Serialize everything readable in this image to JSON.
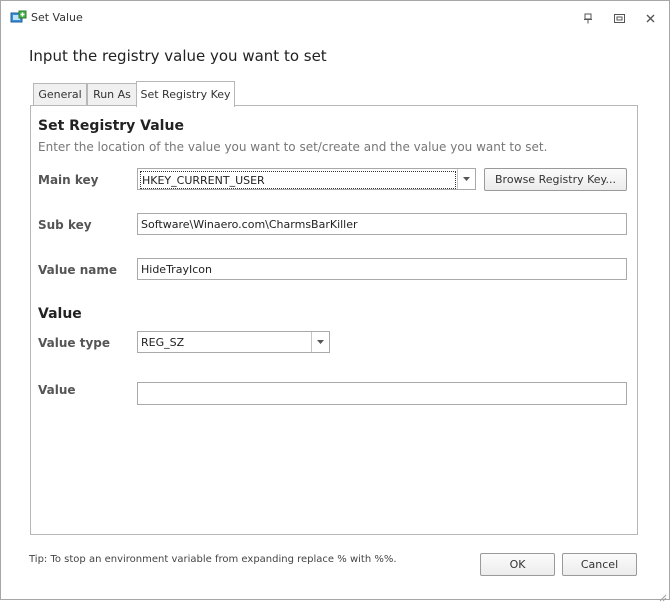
{
  "window": {
    "title": "Set Value",
    "icon": "registry-window-icon",
    "controls": [
      "pin-icon",
      "restore-icon",
      "close-icon"
    ]
  },
  "heading": "Input the registry value you want to set",
  "tabs": [
    {
      "label": "General",
      "active": false
    },
    {
      "label": "Run As",
      "active": false
    },
    {
      "label": "Set Registry Key",
      "active": true
    }
  ],
  "registry": {
    "section_title": "Set Registry Value",
    "description": "Enter the location of the value you want to set/create and the value you want to set.",
    "main_key_label": "Main key",
    "main_key_value": "HKEY_CURRENT_USER",
    "browse_label": "Browse Registry Key...",
    "sub_key_label": "Sub key",
    "sub_key_value": "Software\\Winaero.com\\CharmsBarKiller",
    "value_name_label": "Value name",
    "value_name_value": "HideTrayIcon"
  },
  "value_section": {
    "title": "Value",
    "type_label": "Value type",
    "type_value": "REG_SZ",
    "value_label": "Value",
    "value_value": ""
  },
  "footer": {
    "tip": "Tip: To stop an environment variable from expanding replace % with %%.",
    "ok_label": "OK",
    "cancel_label": "Cancel"
  },
  "colors": {
    "border": "#b7b7b7",
    "label": "#555555",
    "description": "#777777"
  }
}
